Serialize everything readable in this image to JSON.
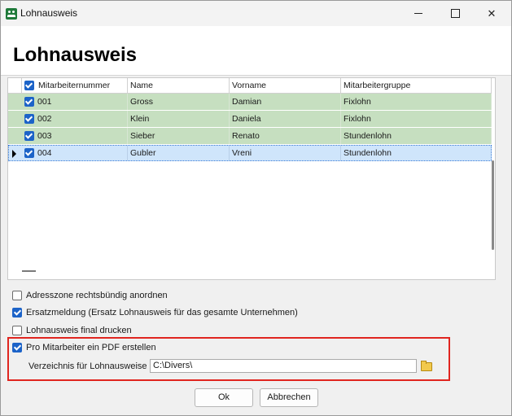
{
  "window": {
    "title": "Lohnausweis"
  },
  "page": {
    "title": "Lohnausweis"
  },
  "grid": {
    "columns": [
      "Mitarbeiternummer",
      "Name",
      "Vorname",
      "Mitarbeitergruppe"
    ],
    "rows": [
      {
        "number": "001",
        "name": "Gross",
        "vorname": "Damian",
        "gruppe": "Fixlohn",
        "checked": true
      },
      {
        "number": "002",
        "name": "Klein",
        "vorname": "Daniela",
        "gruppe": "Fixlohn",
        "checked": true
      },
      {
        "number": "003",
        "name": "Sieber",
        "vorname": "Renato",
        "gruppe": "Stundenlohn",
        "checked": true
      },
      {
        "number": "004",
        "name": "Gubler",
        "vorname": "Vreni",
        "gruppe": "Stundenlohn",
        "checked": true
      }
    ]
  },
  "options": {
    "adresszone": {
      "label": "Adresszone rechtsbündig anordnen",
      "checked": false
    },
    "ersatz": {
      "label": "Ersatzmeldung (Ersatz Lohnausweis für das gesamte Unternehmen)",
      "checked": true
    },
    "final": {
      "label": "Lohnausweis final drucken",
      "checked": false
    },
    "pdf": {
      "label": "Pro Mitarbeiter ein PDF erstellen",
      "checked": true
    }
  },
  "directory": {
    "label": "Verzeichnis für Lohnausweise",
    "value": "C:\\Divers\\"
  },
  "buttons": {
    "ok": "Ok",
    "cancel": "Abbrechen"
  },
  "colors": {
    "accent": "#1c63c8",
    "row_green": "#c6dfc0",
    "row_selected": "#cfe5fb",
    "highlight_frame": "#e0251f"
  }
}
